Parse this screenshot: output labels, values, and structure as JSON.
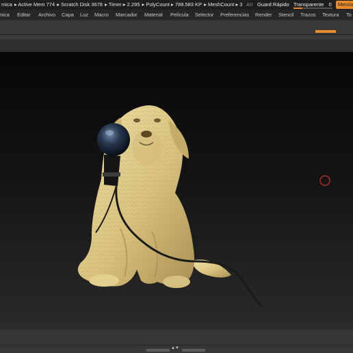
{
  "topbar": {
    "stats": [
      "mica",
      "▸ Active Mem 774",
      "▸ Scratch Disk 3678",
      "▸ Timer ▸ 2.295",
      "▸ PolyCount ▸ 788.583 KP",
      "▸ MeshCount ▸ 3"
    ],
    "ai_label": "AII",
    "quicksave_label": "Guard Rápido",
    "transparency_label": "Transparente",
    "transparency_value": "0",
    "transparency_level": 0.22,
    "menus_button": "Menús",
    "accent_color": "#e98b2a"
  },
  "menubar": {
    "items": [
      "mica",
      "Editar",
      "Archivo",
      "Capa",
      "Luz",
      "Macro",
      "Marcador",
      "Material",
      "Película",
      "Selector",
      "Preferencias",
      "Render",
      "Stencil",
      "Trazos",
      "Textura",
      "To"
    ]
  },
  "viewport": {
    "model": "dog-sculpt-with-microphone",
    "cursor_icon": "brush-cursor-icon"
  },
  "bottombar": {
    "center_icon": "expand-arrows-icon"
  }
}
